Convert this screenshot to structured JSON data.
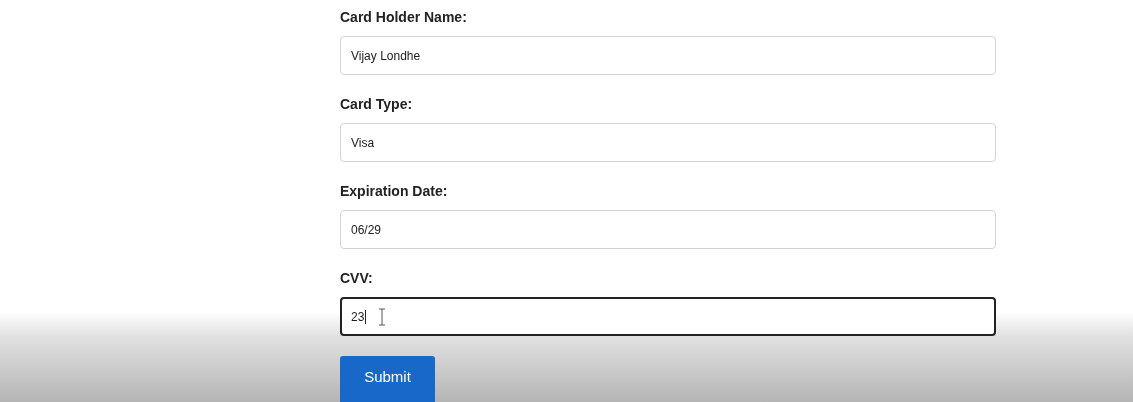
{
  "form": {
    "fields": [
      {
        "label": "Card Holder Name:",
        "value": "Vijay Londhe",
        "focused": false
      },
      {
        "label": "Card Type:",
        "value": "Visa",
        "focused": false
      },
      {
        "label": "Expiration Date:",
        "value": "06/29",
        "focused": false
      },
      {
        "label": "CVV:",
        "value": "23",
        "focused": true
      }
    ],
    "submit": "Submit"
  }
}
